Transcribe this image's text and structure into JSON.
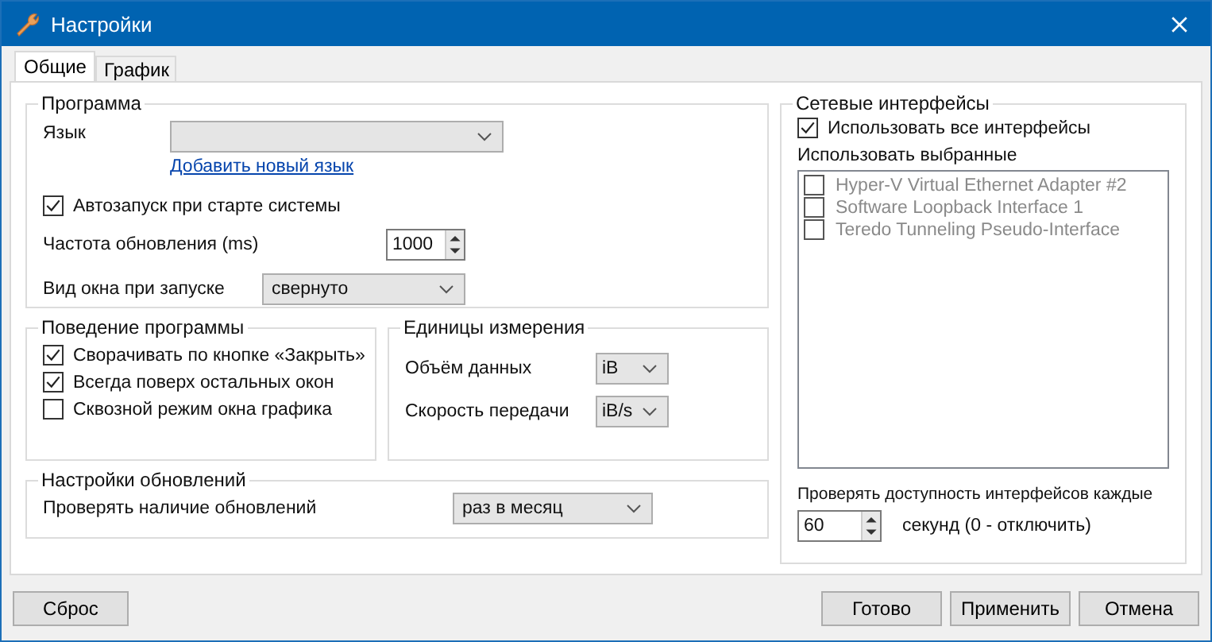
{
  "window": {
    "title": "Настройки"
  },
  "tabs": [
    {
      "label": "Общие",
      "selected": true
    },
    {
      "label": "График",
      "selected": false
    }
  ],
  "program": {
    "title": "Программа",
    "language_label": "Язык",
    "add_language_link": "Добавить новый язык",
    "autostart": {
      "label": "Автозапуск при старте системы",
      "checked": true
    },
    "refresh_label": "Частота обновления (ms)",
    "refresh_value": "1000",
    "window_mode_label": "Вид окна при запуске",
    "window_mode_value": "свернуто"
  },
  "behavior": {
    "title": "Поведение программы",
    "options": [
      {
        "label": "Сворачивать по кнопке «Закрыть»",
        "checked": true
      },
      {
        "label": "Всегда поверх остальных окон",
        "checked": true
      },
      {
        "label": "Сквозной режим окна графика",
        "checked": false
      }
    ]
  },
  "units": {
    "title": "Единицы измерения",
    "rows": [
      {
        "label": "Объём данных",
        "value": "iB"
      },
      {
        "label": "Скорость передачи",
        "value": "iB/s"
      }
    ]
  },
  "updates": {
    "title": "Настройки обновлений",
    "label": "Проверять наличие обновлений",
    "value": "раз в месяц"
  },
  "network": {
    "title": "Сетевые интерфейсы",
    "use_all": {
      "label": "Использовать все интерфейсы",
      "checked": true
    },
    "selected_label": "Использовать выбранные",
    "interfaces": [
      {
        "label": "Hyper-V Virtual Ethernet Adapter #2",
        "checked": false,
        "disabled": true
      },
      {
        "label": "Software Loopback Interface 1",
        "checked": false,
        "disabled": true
      },
      {
        "label": "Teredo Tunneling Pseudo-Interface",
        "checked": false,
        "disabled": true
      }
    ],
    "check_label": "Проверять доступность интерфейсов каждые",
    "check_value": "60",
    "check_hint": "секунд (0 - отключить)"
  },
  "buttons": {
    "reset": "Сброс",
    "right": [
      "Готово",
      "Применить",
      "Отмена"
    ]
  }
}
